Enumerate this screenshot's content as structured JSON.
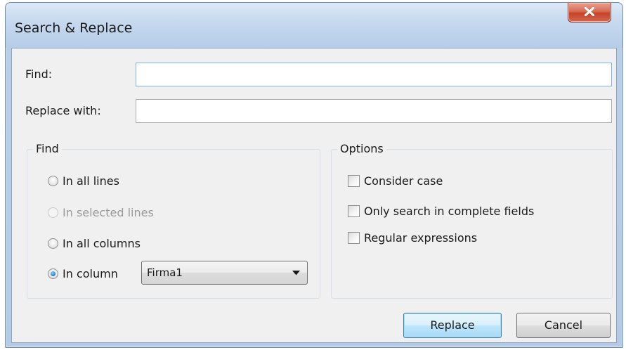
{
  "window": {
    "title": "Search & Replace",
    "close_glyph": "X"
  },
  "fields": {
    "find_label": "Find:",
    "find_value": "",
    "replace_label": "Replace with:",
    "replace_value": ""
  },
  "find_group": {
    "title": "Find",
    "options": [
      {
        "label": "In all lines",
        "checked": false,
        "enabled": true
      },
      {
        "label": "In selected lines",
        "checked": false,
        "enabled": false
      },
      {
        "label": "In all columns",
        "checked": false,
        "enabled": true
      },
      {
        "label": "In column",
        "checked": true,
        "enabled": true
      }
    ],
    "column_select": {
      "value": "Firma1"
    }
  },
  "options_group": {
    "title": "Options",
    "checkboxes": [
      {
        "label": "Consider case",
        "checked": false
      },
      {
        "label": "Only search in complete fields",
        "checked": false
      },
      {
        "label": "Regular expressions",
        "checked": false
      }
    ]
  },
  "buttons": {
    "replace_label": "Replace",
    "cancel_label": "Cancel"
  }
}
